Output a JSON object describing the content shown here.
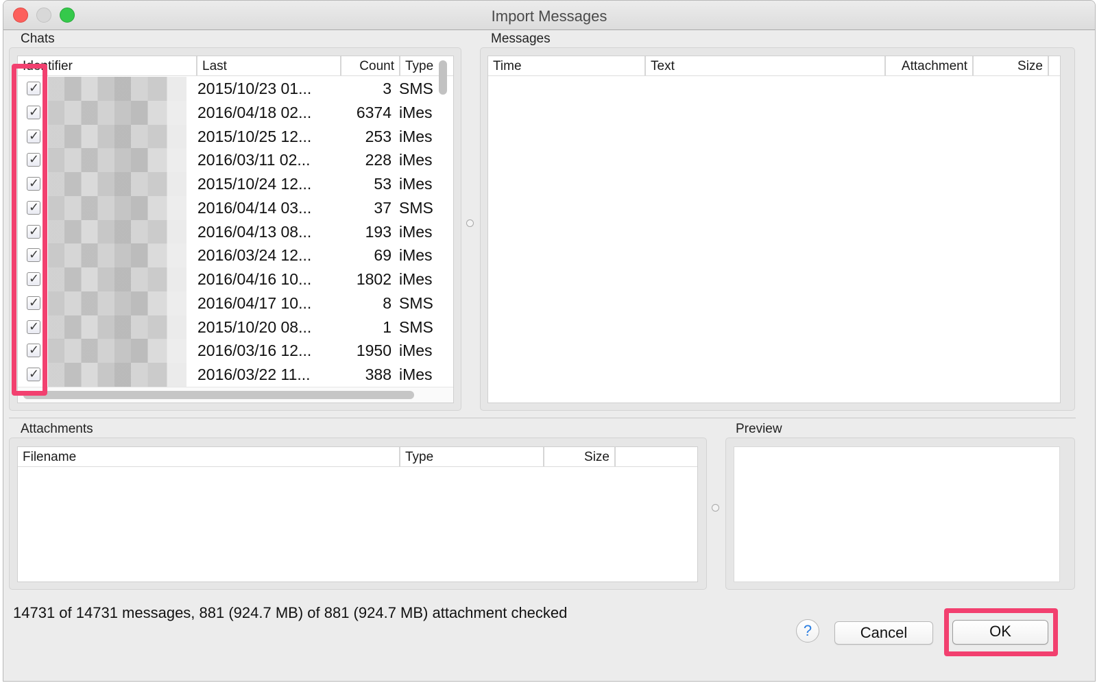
{
  "window": {
    "title": "Import Messages"
  },
  "chats": {
    "label": "Chats",
    "columns": {
      "identifier": "Identifier",
      "last": "Last",
      "count": "Count",
      "type": "Type"
    },
    "rows": [
      {
        "checked": true,
        "last": "2015/10/23 01...",
        "count": "3",
        "type": "SMS"
      },
      {
        "checked": true,
        "last": "2016/04/18 02...",
        "count": "6374",
        "type": "iMes"
      },
      {
        "checked": true,
        "last": "2015/10/25 12...",
        "count": "253",
        "type": "iMes"
      },
      {
        "checked": true,
        "last": "2016/03/11 02...",
        "count": "228",
        "type": "iMes"
      },
      {
        "checked": true,
        "last": "2015/10/24 12...",
        "count": "53",
        "type": "iMes"
      },
      {
        "checked": true,
        "last": "2016/04/14 03...",
        "count": "37",
        "type": "SMS"
      },
      {
        "checked": true,
        "last": "2016/04/13 08...",
        "count": "193",
        "type": "iMes"
      },
      {
        "checked": true,
        "last": "2016/03/24 12...",
        "count": "69",
        "type": "iMes"
      },
      {
        "checked": true,
        "last": "2016/04/16 10...",
        "count": "1802",
        "type": "iMes"
      },
      {
        "checked": true,
        "last": "2016/04/17 10...",
        "count": "8",
        "type": "SMS"
      },
      {
        "checked": true,
        "last": "2015/10/20 08...",
        "count": "1",
        "type": "SMS"
      },
      {
        "checked": true,
        "last": "2016/03/16 12...",
        "count": "1950",
        "type": "iMes"
      },
      {
        "checked": true,
        "last": "2016/03/22 11...",
        "count": "388",
        "type": "iMes"
      }
    ]
  },
  "messages": {
    "label": "Messages",
    "columns": {
      "time": "Time",
      "text": "Text",
      "attachment": "Attachment",
      "size": "Size"
    }
  },
  "attachments": {
    "label": "Attachments",
    "columns": {
      "filename": "Filename",
      "type": "Type",
      "size": "Size"
    }
  },
  "preview": {
    "label": "Preview"
  },
  "status": {
    "text": "14731 of 14731 messages, 881 (924.7 MB) of 881 (924.7 MB) attachment checked"
  },
  "buttons": {
    "help": "?",
    "cancel": "Cancel",
    "ok": "OK"
  },
  "icons": {
    "checkmark": "checkmark-icon",
    "help": "question-mark-icon"
  },
  "colors": {
    "highlight": "#f2406f",
    "close": "#fc605c",
    "zoom": "#35c94b",
    "help_glyph": "#2a7de1"
  }
}
